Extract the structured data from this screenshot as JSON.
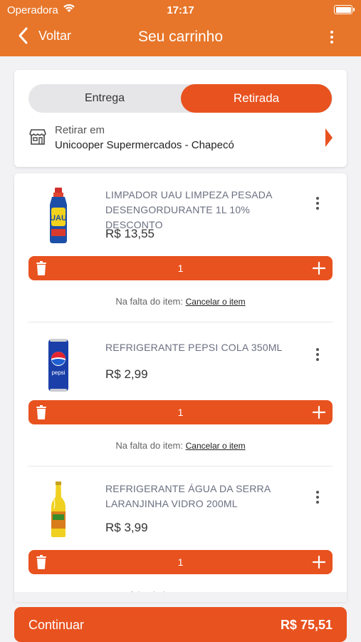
{
  "status_bar": {
    "carrier": "Operadora",
    "time": "17:17"
  },
  "header": {
    "back_label": "Voltar",
    "title": "Seu carrinho"
  },
  "delivery": {
    "tabs": [
      "Entrega",
      "Retirada"
    ],
    "selected_tab": "Retirada",
    "pickup_label": "Retirar em",
    "pickup_store": "Unicooper Supermercados - Chapecó"
  },
  "cart": {
    "missing_label": "Na falta do item:",
    "missing_action": "Cancelar o item",
    "items": [
      {
        "name": "LIMPADOR UAU LIMPEZA PESADA DESENGORDURANTE 1L 10% DESCONTO",
        "price": "R$ 13,55",
        "quantity": "1",
        "image": "cleaner-bottle"
      },
      {
        "name": "REFRIGERANTE PEPSI COLA 350ML",
        "price": "R$ 2,99",
        "quantity": "1",
        "image": "pepsi-can"
      },
      {
        "name": "REFRIGERANTE ÁGUA DA SERRA LARANJINHA VIDRO 200ML",
        "price": "R$ 3,99",
        "quantity": "1",
        "image": "soda-glass-bottle"
      }
    ]
  },
  "footer": {
    "continue_label": "Continuar",
    "total": "R$ 75,51"
  },
  "colors": {
    "header": "#e7762a",
    "accent": "#e8521f",
    "background": "#f2f2f4"
  }
}
